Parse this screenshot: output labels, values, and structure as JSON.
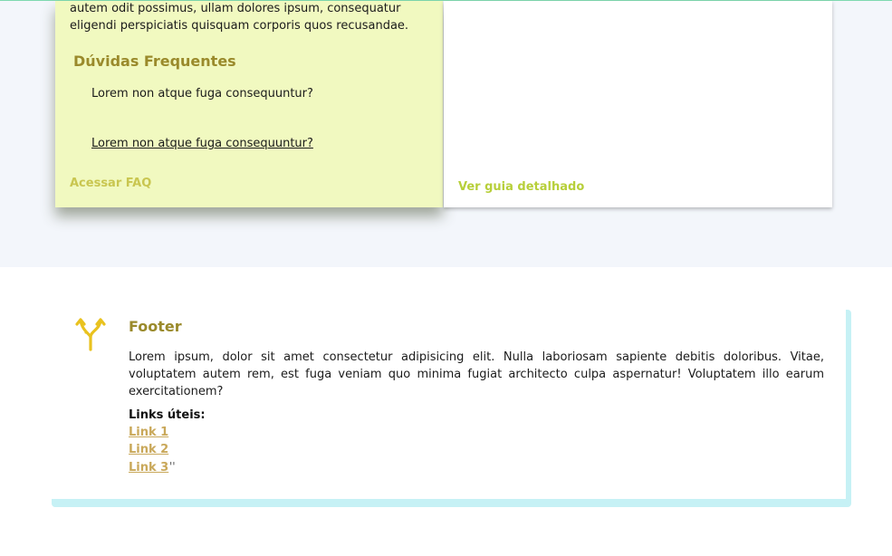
{
  "faq_card": {
    "intro_text": "autem odit possimus, ullam dolores ipsum, consequatur eligendi perspiciatis quisquam corporis quos recusandae.",
    "title": "Dúvidas Frequentes",
    "questions": [
      "Lorem non atque fuga consequuntur?",
      "Lorem non atque fuga consequuntur?"
    ],
    "link_label": "Acessar FAQ"
  },
  "guide_card": {
    "link_label": "Ver guia detalhado"
  },
  "footer": {
    "icon": "merge-arrows-icon",
    "title": "Footer",
    "text": "Lorem ipsum, dolor sit amet consectetur adipisicing elit. Nulla laboriosam sapiente debitis doloribus. Vitae, voluptatem autem rem, est fuga veniam quo minima fugiat architecto culpa aspernatur! Voluptatem illo earum exercitationem?",
    "links_label": "Links úteis:",
    "links": [
      "Link 1",
      "Link 2",
      "Link 3"
    ],
    "trailing_mark": "''"
  },
  "colors": {
    "top_band": "#f3f6fb",
    "faq_card_bg": "#f1f9c0",
    "title_color": "#9a8a2b",
    "faq_link": "#c9c650",
    "guide_link": "#b7cf3a",
    "footer_link": "#c9a85a",
    "footer_border": "#c6f1f5",
    "icon_color": "#e9c21f"
  }
}
